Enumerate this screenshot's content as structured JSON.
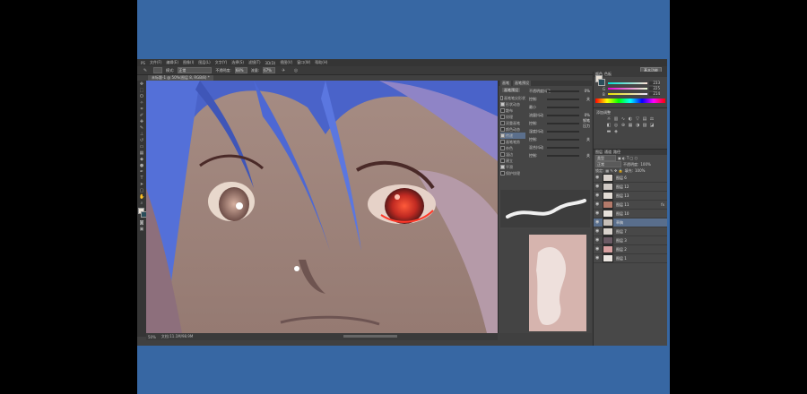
{
  "colors": {
    "frame_blue": "#3767a3",
    "ps_bg": "#404040",
    "accent_layer": "#596e8c"
  },
  "app": {
    "menu": [
      "PS",
      "文件(F)",
      "编辑(E)",
      "图像(I)",
      "图层(L)",
      "文字(Y)",
      "选择(S)",
      "滤镜(T)",
      "3D(D)",
      "视图(V)",
      "窗口(W)",
      "帮助(H)"
    ],
    "workspace_button": "基本功能",
    "options": {
      "mode_label": "模式:",
      "mode_value": "正常",
      "opacity_label": "不透明度:",
      "opacity_value": "68%",
      "flow_label": "流量:",
      "flow_value": "67%"
    },
    "doc_tab": "未标题-1 @ 50%(图层 8, RGB/8) *"
  },
  "status": {
    "zoom": "50%",
    "doc": "文档:11.1M/98.9M"
  },
  "brush_panel": {
    "tabs": [
      "画笔",
      "画笔预设"
    ],
    "preset_button": "画笔预设",
    "items": [
      {
        "label": "画笔笔尖形状",
        "checked": false,
        "selected": false
      },
      {
        "label": "形状动态",
        "checked": true,
        "selected": false
      },
      {
        "label": "散布",
        "checked": false,
        "selected": false
      },
      {
        "label": "纹理",
        "checked": false,
        "selected": false
      },
      {
        "label": "双重画笔",
        "checked": false,
        "selected": false
      },
      {
        "label": "颜色动态",
        "checked": false,
        "selected": false
      },
      {
        "label": "传递",
        "checked": true,
        "selected": true
      },
      {
        "label": "画笔笔势",
        "checked": false,
        "selected": false
      },
      {
        "label": "杂色",
        "checked": false,
        "selected": false
      },
      {
        "label": "湿边",
        "checked": false,
        "selected": false
      },
      {
        "label": "建立",
        "checked": false,
        "selected": false
      },
      {
        "label": "平滑",
        "checked": true,
        "selected": false
      },
      {
        "label": "保护纹理",
        "checked": false,
        "selected": false
      }
    ],
    "controls": [
      {
        "label": "不透明度抖动",
        "value": "0%"
      },
      {
        "label": "控制:",
        "value": "关"
      },
      {
        "label": "最小",
        "value": ""
      },
      {
        "label": "流量抖动",
        "value": "0%"
      },
      {
        "label": "控制:",
        "value": "钢笔压力"
      },
      {
        "label": "湿度抖动",
        "value": ""
      },
      {
        "label": "控制:",
        "value": "关"
      },
      {
        "label": "混合抖动",
        "value": ""
      },
      {
        "label": "控制:",
        "value": "关"
      }
    ]
  },
  "color_panel": {
    "tabs": [
      "颜色",
      "色板"
    ],
    "rows": [
      {
        "label": "R",
        "value": "233"
      },
      {
        "label": "G",
        "value": "225"
      },
      {
        "label": "B",
        "value": "214"
      }
    ]
  },
  "adjust_panel": {
    "title": "添加调整"
  },
  "layers_panel": {
    "tabs": [
      "图层",
      "通道",
      "路径"
    ],
    "kind": "类型",
    "blend": "正常",
    "opacity_label": "不透明度:",
    "opacity_value": "100%",
    "lock_label": "锁定:",
    "fill_label": "填充:",
    "fill_value": "100%",
    "layers": [
      {
        "name": "图层 6",
        "thumb": "#d9d2cc",
        "active": false,
        "fx": ""
      },
      {
        "name": "图层 12",
        "thumb": "#cfc9c4",
        "active": false,
        "fx": ""
      },
      {
        "name": "图层 13",
        "thumb": "#e3dcd5",
        "active": false,
        "fx": ""
      },
      {
        "name": "图层 11",
        "thumb": "#b37a6a",
        "active": false,
        "fx": "fx"
      },
      {
        "name": "图层 10",
        "thumb": "#e6e0da",
        "active": false,
        "fx": ""
      },
      {
        "name": "草稿",
        "thumb": "#c7bfb8",
        "active": true,
        "fx": ""
      },
      {
        "name": "图层 7",
        "thumb": "#d8d2cc",
        "active": false,
        "fx": ""
      },
      {
        "name": "图层 3",
        "thumb": "#6a5a64",
        "active": false,
        "fx": ""
      },
      {
        "name": "图层 2",
        "thumb": "#d7a0a0",
        "active": false,
        "fx": ""
      },
      {
        "name": "图层 1",
        "thumb": "#eae5e0",
        "active": false,
        "fx": ""
      }
    ]
  }
}
